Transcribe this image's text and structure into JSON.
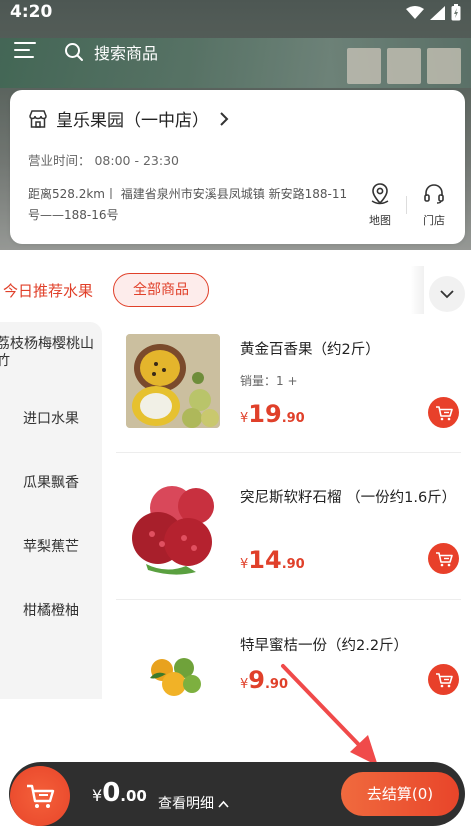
{
  "status_bar": {
    "time": "4:20"
  },
  "search": {
    "placeholder": "搜索商品"
  },
  "store": {
    "name": "皇乐果园（一中店）",
    "hours": "营业时间：  08:00 - 23:30",
    "address": "距离528.2km丨 福建省泉州市安溪县凤城镇 新安路188-11号——188-16号",
    "map_label": "地图",
    "store_label": "门店"
  },
  "tabs": {
    "today": "今日推荐水果",
    "all": "全部商品"
  },
  "sidebar": {
    "items": [
      {
        "label": "荔枝杨梅樱桃山竹"
      },
      {
        "label": "进口水果"
      },
      {
        "label": "瓜果飘香"
      },
      {
        "label": "苹梨蕉芒"
      },
      {
        "label": "柑橘橙柚"
      }
    ]
  },
  "products": [
    {
      "name": "黄金百香果（约2斤）",
      "sold": "销量：1 +",
      "price_yen": "¥",
      "price_int": "19",
      "price_dec": ".90"
    },
    {
      "name": "突尼斯软籽石榴 （一份约1.6斤）",
      "sold": "",
      "price_yen": "¥",
      "price_int": "14",
      "price_dec": ".90"
    },
    {
      "name": "特早蜜桔一份（约2.2斤）",
      "sold": "",
      "price_yen": "¥",
      "price_int": "9",
      "price_dec": ".90"
    }
  ],
  "cart": {
    "total_yen": "¥",
    "total_int": "0",
    "total_dec": ".00",
    "details_label": "查看明细",
    "checkout_label": "去结算(0)"
  },
  "colors": {
    "accent": "#e8402a",
    "bar": "#2f2f2f"
  },
  "icons": [
    "menu-icon",
    "search-icon",
    "store-icon",
    "chevron-right-icon",
    "map-pin-icon",
    "headset-icon",
    "chevron-down-icon",
    "cart-icon",
    "chevron-up-icon"
  ]
}
